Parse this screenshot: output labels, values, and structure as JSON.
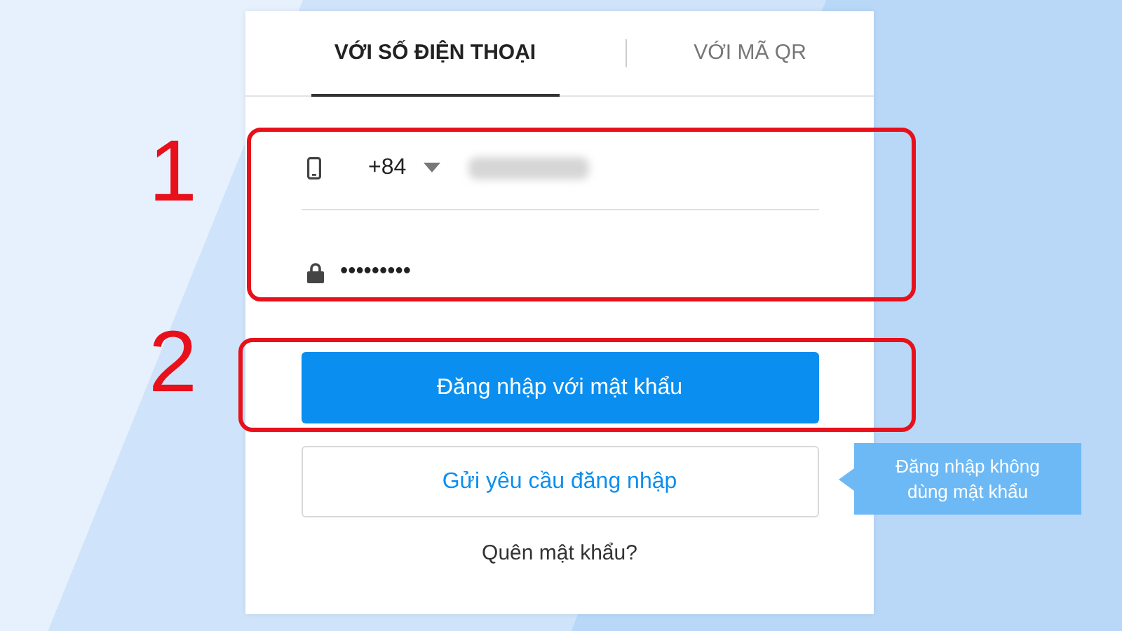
{
  "tabs": [
    {
      "label": "VỚI SỐ ĐIỆN THOẠI",
      "selected": true
    },
    {
      "label": "VỚI MÃ QR",
      "selected": false
    }
  ],
  "phone_field": {
    "country_code": "+84"
  },
  "password_field": {
    "value": "•••••••••"
  },
  "buttons": [
    {
      "label": "Đăng nhập với mật khẩu",
      "kind": "primary"
    },
    {
      "label": "Gửi yêu cầu đăng nhập",
      "kind": "outline"
    }
  ],
  "tooltip": "Đăng nhập không dùng mật khẩu",
  "forgot_link": "Quên mật khẩu?",
  "annotations": [
    {
      "label": "1"
    },
    {
      "label": "2"
    }
  ]
}
